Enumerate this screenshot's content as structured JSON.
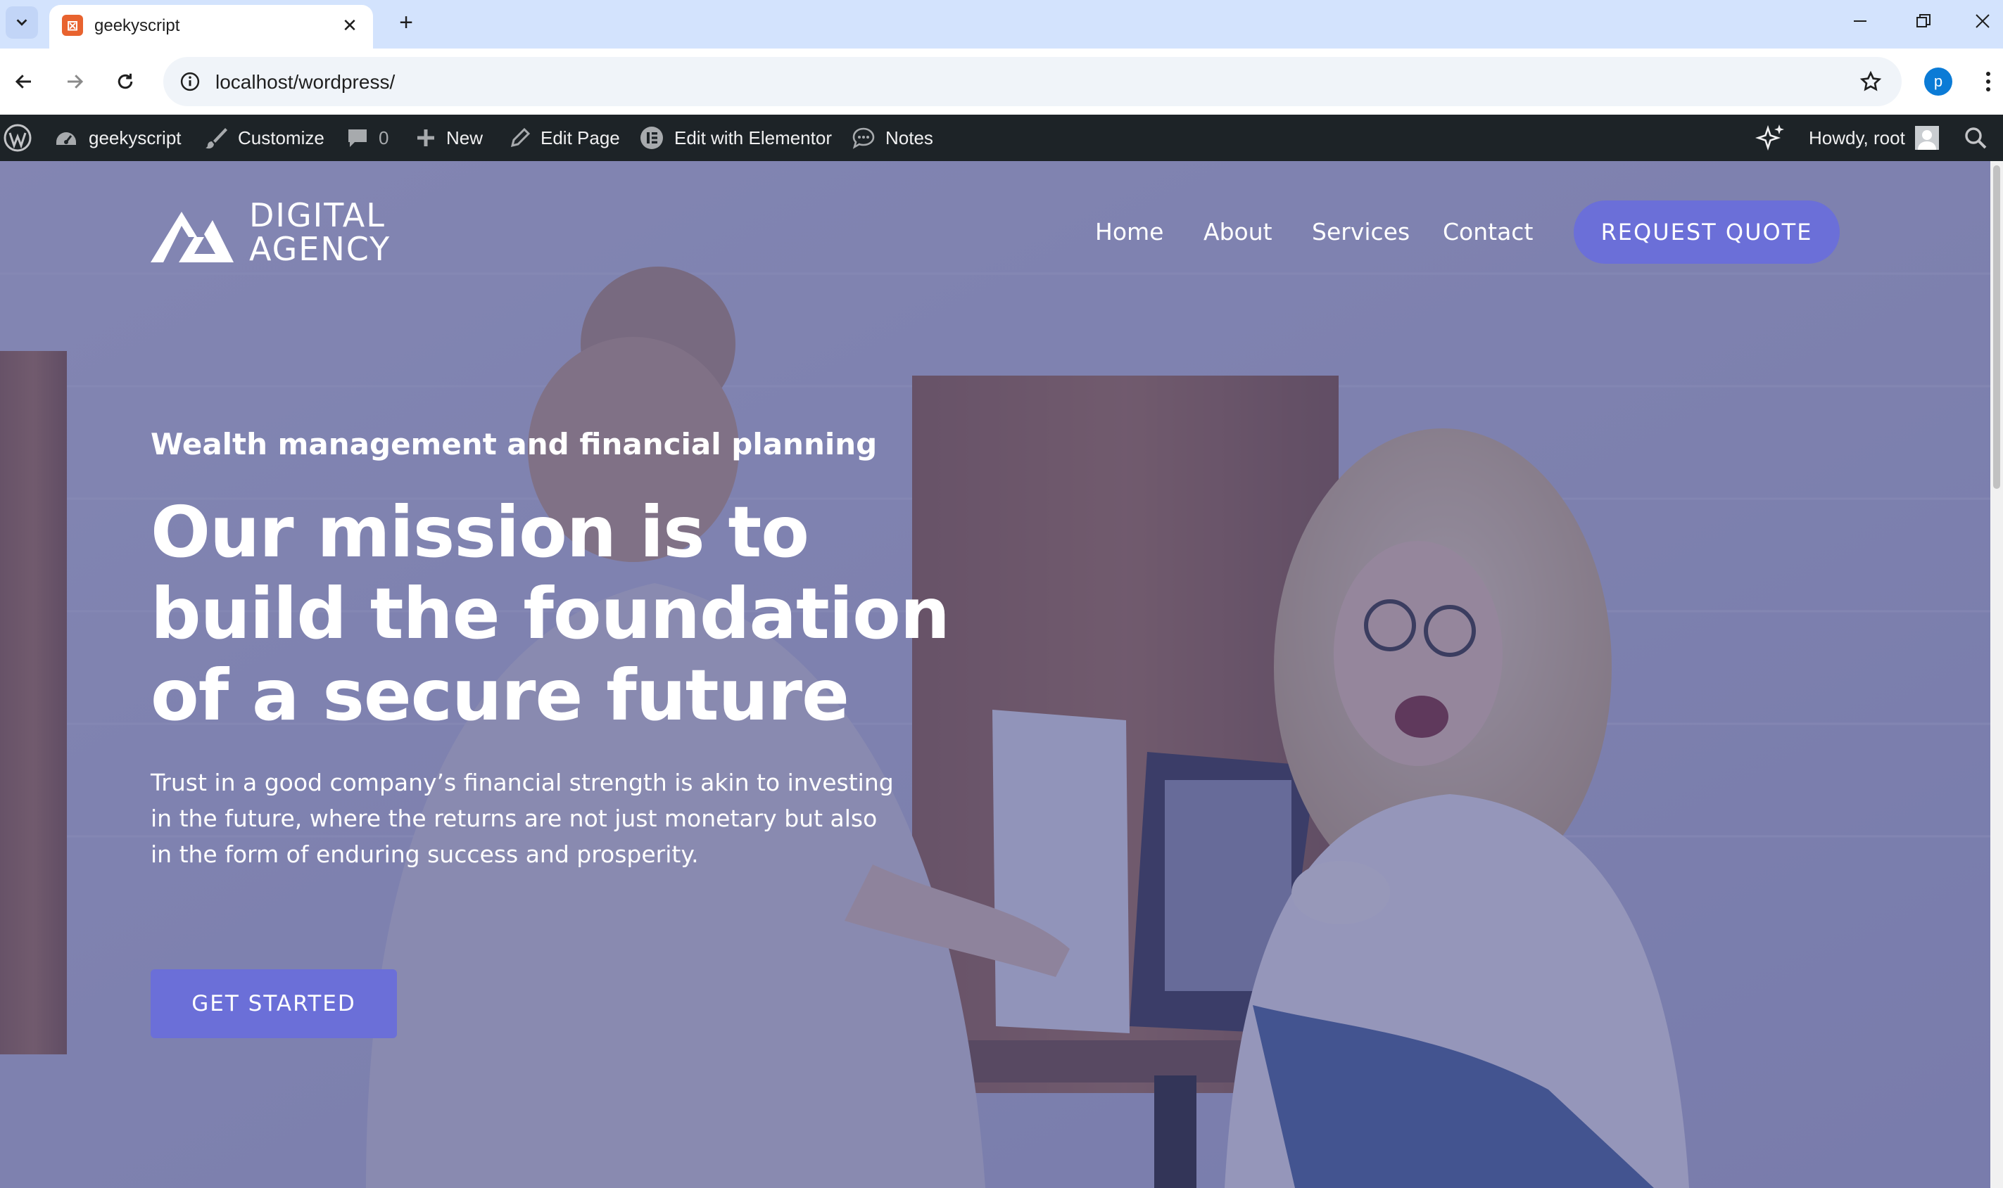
{
  "browser": {
    "tab_title": "geekyscript",
    "url": "localhost/wordpress/",
    "profile_initial": "p"
  },
  "adminbar": {
    "site_name": "geekyscript",
    "customize": "Customize",
    "comments_count": "0",
    "new": "New",
    "edit_page": "Edit Page",
    "edit_elementor": "Edit with Elementor",
    "notes": "Notes",
    "howdy": "Howdy, root"
  },
  "site": {
    "logo_line1": "DIGITAL",
    "logo_line2": "AGENCY",
    "nav": [
      "Home",
      "About",
      "Services",
      "Contact"
    ],
    "quote_button": "REQUEST QUOTE",
    "eyebrow": "Wealth management and financial planning",
    "headline": "Our mission is to build the foundation of a secure future",
    "body": "Trust in a good company’s financial strength is akin to investing in the future, where the returns are not just monetary but also in the form of enduring success and prosperity.",
    "cta": "GET STARTED"
  },
  "colors": {
    "accent": "#6b6fd8",
    "overlay": "#484c8c",
    "adminbar": "#1d2327",
    "tabstrip": "#d3e3fd"
  }
}
